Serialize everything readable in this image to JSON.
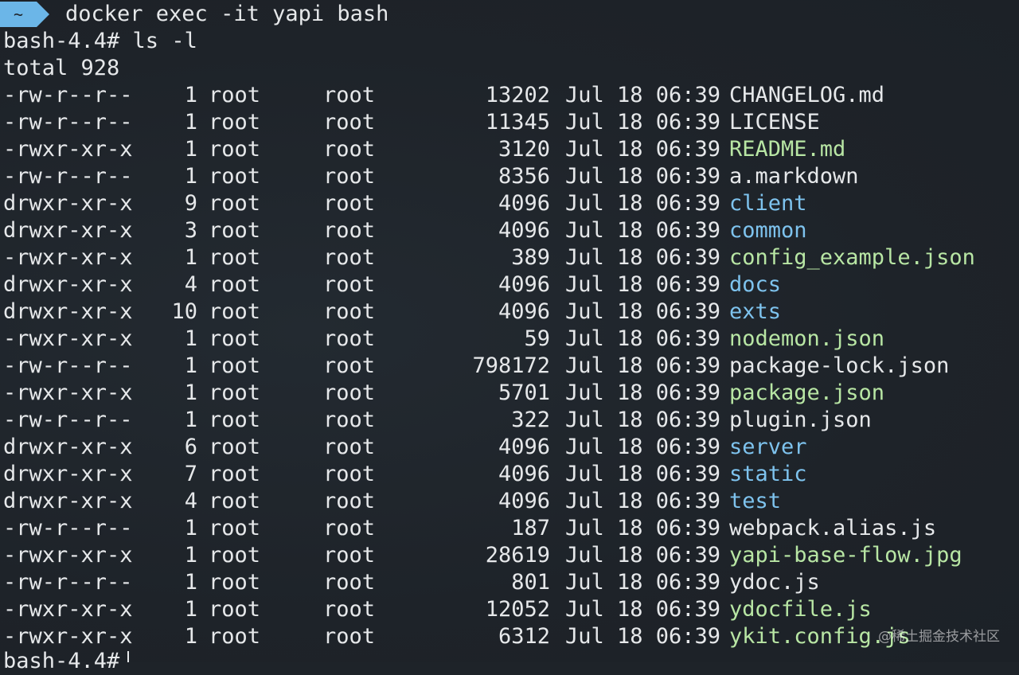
{
  "prompt": {
    "badge": "~",
    "command": "docker exec -it yapi bash"
  },
  "shell_prompt": "bash-4.4# ls -l",
  "total": "total 928",
  "listing": [
    {
      "perm": "-rw-r--r--",
      "links": "1",
      "owner": "root",
      "group": "root",
      "size": "13202",
      "date": "Jul 18 06:39",
      "name": "CHANGELOG.md",
      "kind": "file"
    },
    {
      "perm": "-rw-r--r--",
      "links": "1",
      "owner": "root",
      "group": "root",
      "size": "11345",
      "date": "Jul 18 06:39",
      "name": "LICENSE",
      "kind": "file"
    },
    {
      "perm": "-rwxr-xr-x",
      "links": "1",
      "owner": "root",
      "group": "root",
      "size": "3120",
      "date": "Jul 18 06:39",
      "name": "README.md",
      "kind": "exec"
    },
    {
      "perm": "-rw-r--r--",
      "links": "1",
      "owner": "root",
      "group": "root",
      "size": "8356",
      "date": "Jul 18 06:39",
      "name": "a.markdown",
      "kind": "file"
    },
    {
      "perm": "drwxr-xr-x",
      "links": "9",
      "owner": "root",
      "group": "root",
      "size": "4096",
      "date": "Jul 18 06:39",
      "name": "client",
      "kind": "dir"
    },
    {
      "perm": "drwxr-xr-x",
      "links": "3",
      "owner": "root",
      "group": "root",
      "size": "4096",
      "date": "Jul 18 06:39",
      "name": "common",
      "kind": "dir"
    },
    {
      "perm": "-rwxr-xr-x",
      "links": "1",
      "owner": "root",
      "group": "root",
      "size": "389",
      "date": "Jul 18 06:39",
      "name": "config_example.json",
      "kind": "exec"
    },
    {
      "perm": "drwxr-xr-x",
      "links": "4",
      "owner": "root",
      "group": "root",
      "size": "4096",
      "date": "Jul 18 06:39",
      "name": "docs",
      "kind": "dir"
    },
    {
      "perm": "drwxr-xr-x",
      "links": "10",
      "owner": "root",
      "group": "root",
      "size": "4096",
      "date": "Jul 18 06:39",
      "name": "exts",
      "kind": "dir"
    },
    {
      "perm": "-rwxr-xr-x",
      "links": "1",
      "owner": "root",
      "group": "root",
      "size": "59",
      "date": "Jul 18 06:39",
      "name": "nodemon.json",
      "kind": "exec"
    },
    {
      "perm": "-rw-r--r--",
      "links": "1",
      "owner": "root",
      "group": "root",
      "size": "798172",
      "date": "Jul 18 06:39",
      "name": "package-lock.json",
      "kind": "file"
    },
    {
      "perm": "-rwxr-xr-x",
      "links": "1",
      "owner": "root",
      "group": "root",
      "size": "5701",
      "date": "Jul 18 06:39",
      "name": "package.json",
      "kind": "exec"
    },
    {
      "perm": "-rw-r--r--",
      "links": "1",
      "owner": "root",
      "group": "root",
      "size": "322",
      "date": "Jul 18 06:39",
      "name": "plugin.json",
      "kind": "file"
    },
    {
      "perm": "drwxr-xr-x",
      "links": "6",
      "owner": "root",
      "group": "root",
      "size": "4096",
      "date": "Jul 18 06:39",
      "name": "server",
      "kind": "dir"
    },
    {
      "perm": "drwxr-xr-x",
      "links": "7",
      "owner": "root",
      "group": "root",
      "size": "4096",
      "date": "Jul 18 06:39",
      "name": "static",
      "kind": "dir"
    },
    {
      "perm": "drwxr-xr-x",
      "links": "4",
      "owner": "root",
      "group": "root",
      "size": "4096",
      "date": "Jul 18 06:39",
      "name": "test",
      "kind": "dir"
    },
    {
      "perm": "-rw-r--r--",
      "links": "1",
      "owner": "root",
      "group": "root",
      "size": "187",
      "date": "Jul 18 06:39",
      "name": "webpack.alias.js",
      "kind": "file"
    },
    {
      "perm": "-rwxr-xr-x",
      "links": "1",
      "owner": "root",
      "group": "root",
      "size": "28619",
      "date": "Jul 18 06:39",
      "name": "yapi-base-flow.jpg",
      "kind": "exec"
    },
    {
      "perm": "-rw-r--r--",
      "links": "1",
      "owner": "root",
      "group": "root",
      "size": "801",
      "date": "Jul 18 06:39",
      "name": "ydoc.js",
      "kind": "file"
    },
    {
      "perm": "-rwxr-xr-x",
      "links": "1",
      "owner": "root",
      "group": "root",
      "size": "12052",
      "date": "Jul 18 06:39",
      "name": "ydocfile.js",
      "kind": "exec"
    },
    {
      "perm": "-rwxr-xr-x",
      "links": "1",
      "owner": "root",
      "group": "root",
      "size": "6312",
      "date": "Jul 18 06:39",
      "name": "ykit.config.js",
      "kind": "exec"
    }
  ],
  "final_prompt": "bash-4.4#",
  "watermark": "@稀土掘金技术社区",
  "colors": {
    "background": "#1e2329",
    "text": "#e6e8ea",
    "executable": "#b8e6a4",
    "directory": "#7ec3ee",
    "prompt_badge": "#6bb6e8"
  }
}
